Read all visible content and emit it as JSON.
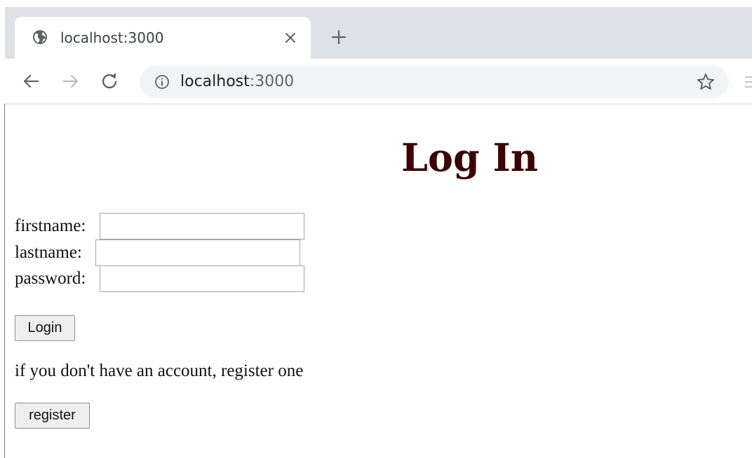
{
  "browser": {
    "tab": {
      "title": "localhost:3000",
      "favicon_icon": "globe-icon",
      "close_icon": "close-icon"
    },
    "new_tab_icon": "plus-icon",
    "nav": {
      "back_icon": "arrow-left-icon",
      "forward_icon": "arrow-right-icon",
      "reload_icon": "reload-icon"
    },
    "address_bar": {
      "info_icon": "info-icon",
      "host": "localhost",
      "port": ":3000",
      "bookmark_icon": "star-icon"
    }
  },
  "page": {
    "title": "Log In",
    "form": {
      "firstname_label": "firstname:",
      "firstname_value": "",
      "lastname_label": "lastname:",
      "lastname_value": "",
      "password_label": "password:",
      "password_value": "",
      "login_button": "Login"
    },
    "register_hint": "if you don't have an account, register one",
    "register_button": "register"
  },
  "colors": {
    "title": "#3d0000",
    "tabstrip": "#dee1e6",
    "omnibox": "#f1f3f4"
  }
}
